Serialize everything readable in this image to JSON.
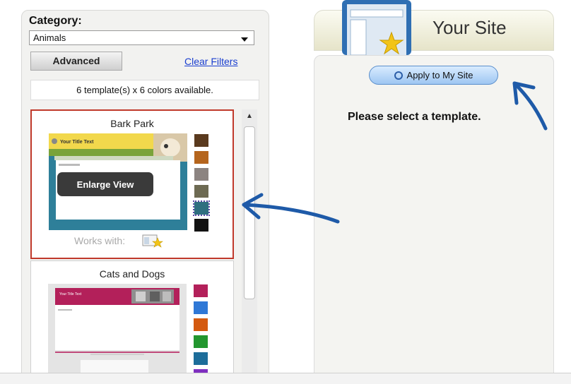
{
  "filters": {
    "category_label": "Category:",
    "category_value": "Animals",
    "advanced_label": "Advanced",
    "clear_label": "Clear Filters",
    "count_text": "6 template(s) x 6 colors available."
  },
  "templates": [
    {
      "name": "Bark Park",
      "preview_title": "Your Title Text",
      "enlarge_label": "Enlarge View",
      "works_with_label": "Works with:",
      "swatch_colors": [
        "#5a3a1e",
        "#b5651d",
        "#8c8481",
        "#6d6a52",
        "#2f6f80",
        "#121212"
      ],
      "selected_swatch": 4
    },
    {
      "name": "Cats and Dogs",
      "preview_title": "Your Title Text",
      "swatch_colors": [
        "#b3205a",
        "#2f78d6",
        "#d45a10",
        "#22962e",
        "#1d6d9a",
        "#7f2fc0"
      ]
    }
  ],
  "site": {
    "title": "Your Site",
    "apply_label": "Apply to My Site",
    "message": "Please select a template."
  },
  "colors": {
    "selected_border": "#c0392b",
    "link": "#1a3ecf",
    "annotation_arrow": "#1e5aa8"
  }
}
